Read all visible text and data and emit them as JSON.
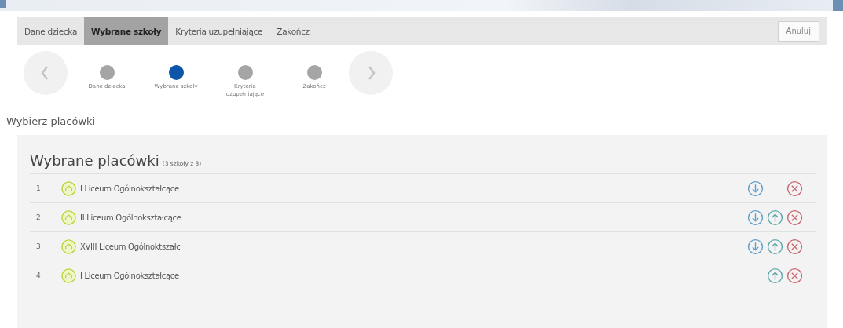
{
  "tabs": [
    {
      "label": "Dane dziecka",
      "selected": false
    },
    {
      "label": "Wybrane szkoły",
      "selected": true
    },
    {
      "label": "Kryteria uzupełniające",
      "selected": false
    },
    {
      "label": "Zakończ",
      "selected": false
    }
  ],
  "cancel_button": "Anuluj",
  "steps": [
    {
      "label": "Dane dziecka",
      "selected": false
    },
    {
      "label": "Wybrane szkoły",
      "selected": true
    },
    {
      "label": "Kryteria uzupełniające",
      "selected": false
    },
    {
      "label": "Zakończ",
      "selected": false
    }
  ],
  "section_title": "Wybierz placówki",
  "panel": {
    "title": "Wybrane placówki",
    "count": "(3 szkoły z 3)",
    "rows": [
      {
        "number": "1",
        "name": "I Liceum Ogólnokształcące",
        "move_down": true,
        "move_up": false
      },
      {
        "number": "2",
        "name": "II Liceum Ogólnokształcące",
        "move_down": true,
        "move_up": true
      },
      {
        "number": "3",
        "name": "XVIII Liceum Ogólnoktszałc",
        "move_down": true,
        "move_up": true
      },
      {
        "number": "4",
        "name": "I Liceum Ogólnokształcące",
        "move_down": false,
        "move_up": true
      }
    ]
  }
}
